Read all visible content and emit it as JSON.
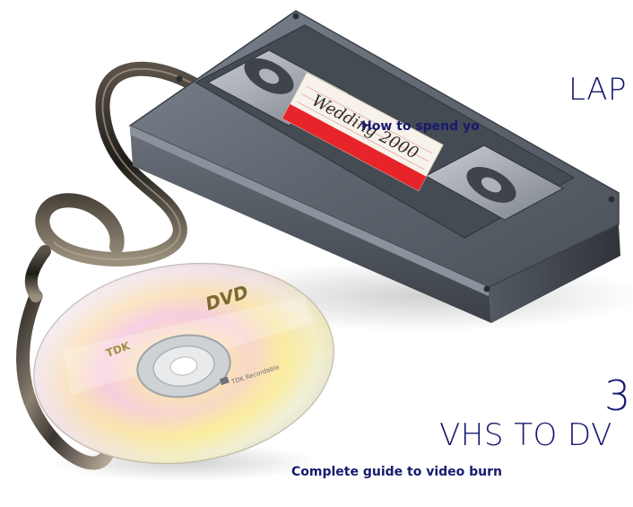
{
  "image": {
    "subject": "VHS cassette with tape unspooling into a DVD disc"
  },
  "cassette": {
    "label_text": "Wedding 2000",
    "label_color": "#e8242b",
    "body_color": "#5a6068"
  },
  "disc": {
    "logo_text": "DVD",
    "brand_text": "TDK",
    "side_text": "TDK Recordable"
  },
  "teaser_1": {
    "headline": "LAP",
    "subline": "How to spend yo"
  },
  "teaser_2": {
    "number": "3",
    "headline": "VHS TO DV",
    "subline": "Complete guide to video burn"
  },
  "colors": {
    "text": "#161a6e",
    "background": "#ffffff"
  }
}
